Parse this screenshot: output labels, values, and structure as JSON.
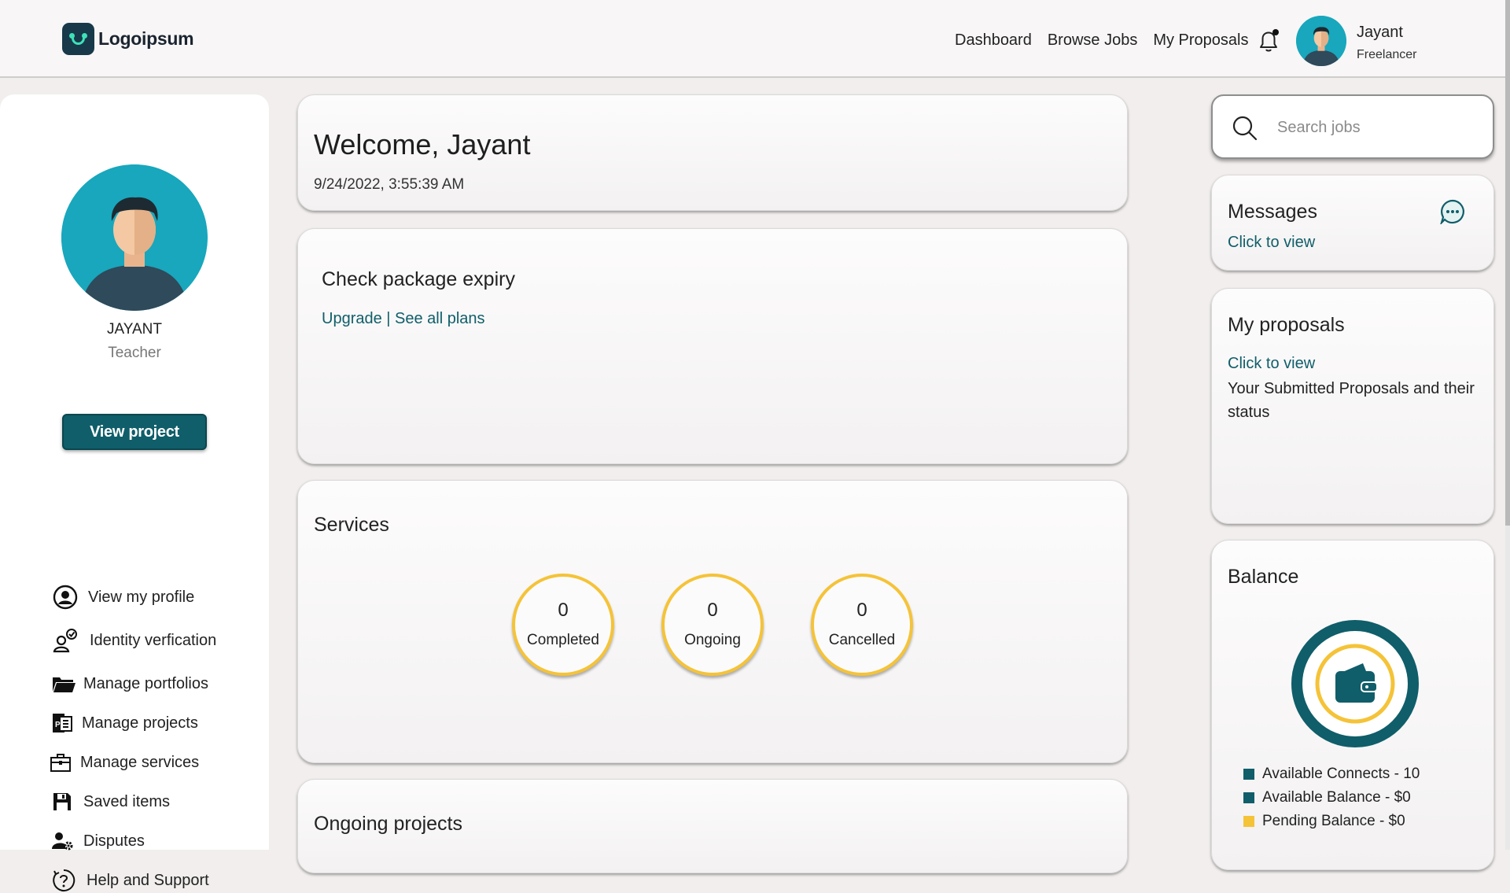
{
  "header": {
    "logo_text": "Logoipsum",
    "nav": [
      "Dashboard",
      "Browse Jobs",
      "My Proposals"
    ],
    "user_name": "Jayant",
    "user_role": "Freelancer"
  },
  "sidebar": {
    "name": "JAYANT",
    "role": "Teacher",
    "view_project_label": "View project",
    "menu": [
      {
        "label": "View my profile",
        "icon": "user-circle-icon"
      },
      {
        "label": "Identity verfication",
        "icon": "identity-check-icon"
      },
      {
        "label": "Manage portfolios",
        "icon": "folder-icon"
      },
      {
        "label": "Manage projects",
        "icon": "projects-icon"
      },
      {
        "label": "Manage services",
        "icon": "briefcase-icon"
      },
      {
        "label": "Saved items",
        "icon": "save-icon"
      },
      {
        "label": "Disputes",
        "icon": "user-gear-icon"
      },
      {
        "label": "Help and Support",
        "icon": "help-icon"
      }
    ]
  },
  "welcome": {
    "title": "Welcome, Jayant",
    "timestamp": "9/24/2022, 3:55:39 AM"
  },
  "package": {
    "title": "Check package expiry",
    "upgrade_link": "Upgrade",
    "separator": " | ",
    "plans_link": "See all plans"
  },
  "services": {
    "title": "Services",
    "stats": [
      {
        "value": "0",
        "label": "Completed"
      },
      {
        "value": "0",
        "label": "Ongoing"
      },
      {
        "value": "0",
        "label": "Cancelled"
      }
    ]
  },
  "ongoing": {
    "title": "Ongoing projects"
  },
  "search": {
    "placeholder": "Search jobs"
  },
  "messages": {
    "title": "Messages",
    "link": "Click to view"
  },
  "proposals": {
    "title": "My proposals",
    "link": "Click to view",
    "description": "Your Submitted Proposals and their status"
  },
  "balance": {
    "title": "Balance",
    "legend": [
      {
        "label": "Available Connects - 10",
        "color": "#0f5e6a"
      },
      {
        "label": "Available Balance - $0",
        "color": "#0f5e6a"
      },
      {
        "label": "Pending Balance - $0",
        "color": "#f5c338"
      }
    ]
  },
  "colors": {
    "accent": "#0f5e6a",
    "highlight": "#f5c338",
    "avatar_bg": "#18a7bd"
  }
}
